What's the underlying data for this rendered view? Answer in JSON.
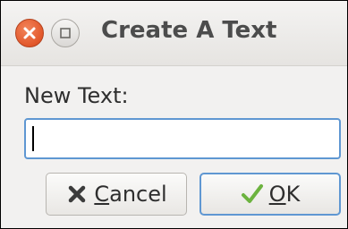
{
  "window": {
    "title": "Create A Text",
    "controls": {
      "close_icon": "close-icon",
      "maximize_icon": "maximize-icon"
    }
  },
  "form": {
    "label": "New Text:",
    "input_value": ""
  },
  "buttons": {
    "cancel": {
      "icon": "x-icon",
      "mnemonic": "C",
      "rest": "ancel"
    },
    "ok": {
      "icon": "checkmark-icon",
      "mnemonic": "O",
      "rest": "K"
    }
  },
  "colors": {
    "close_button": "#e2572a",
    "focus_border": "#5f97d2",
    "checkmark": "#6cb33f"
  }
}
